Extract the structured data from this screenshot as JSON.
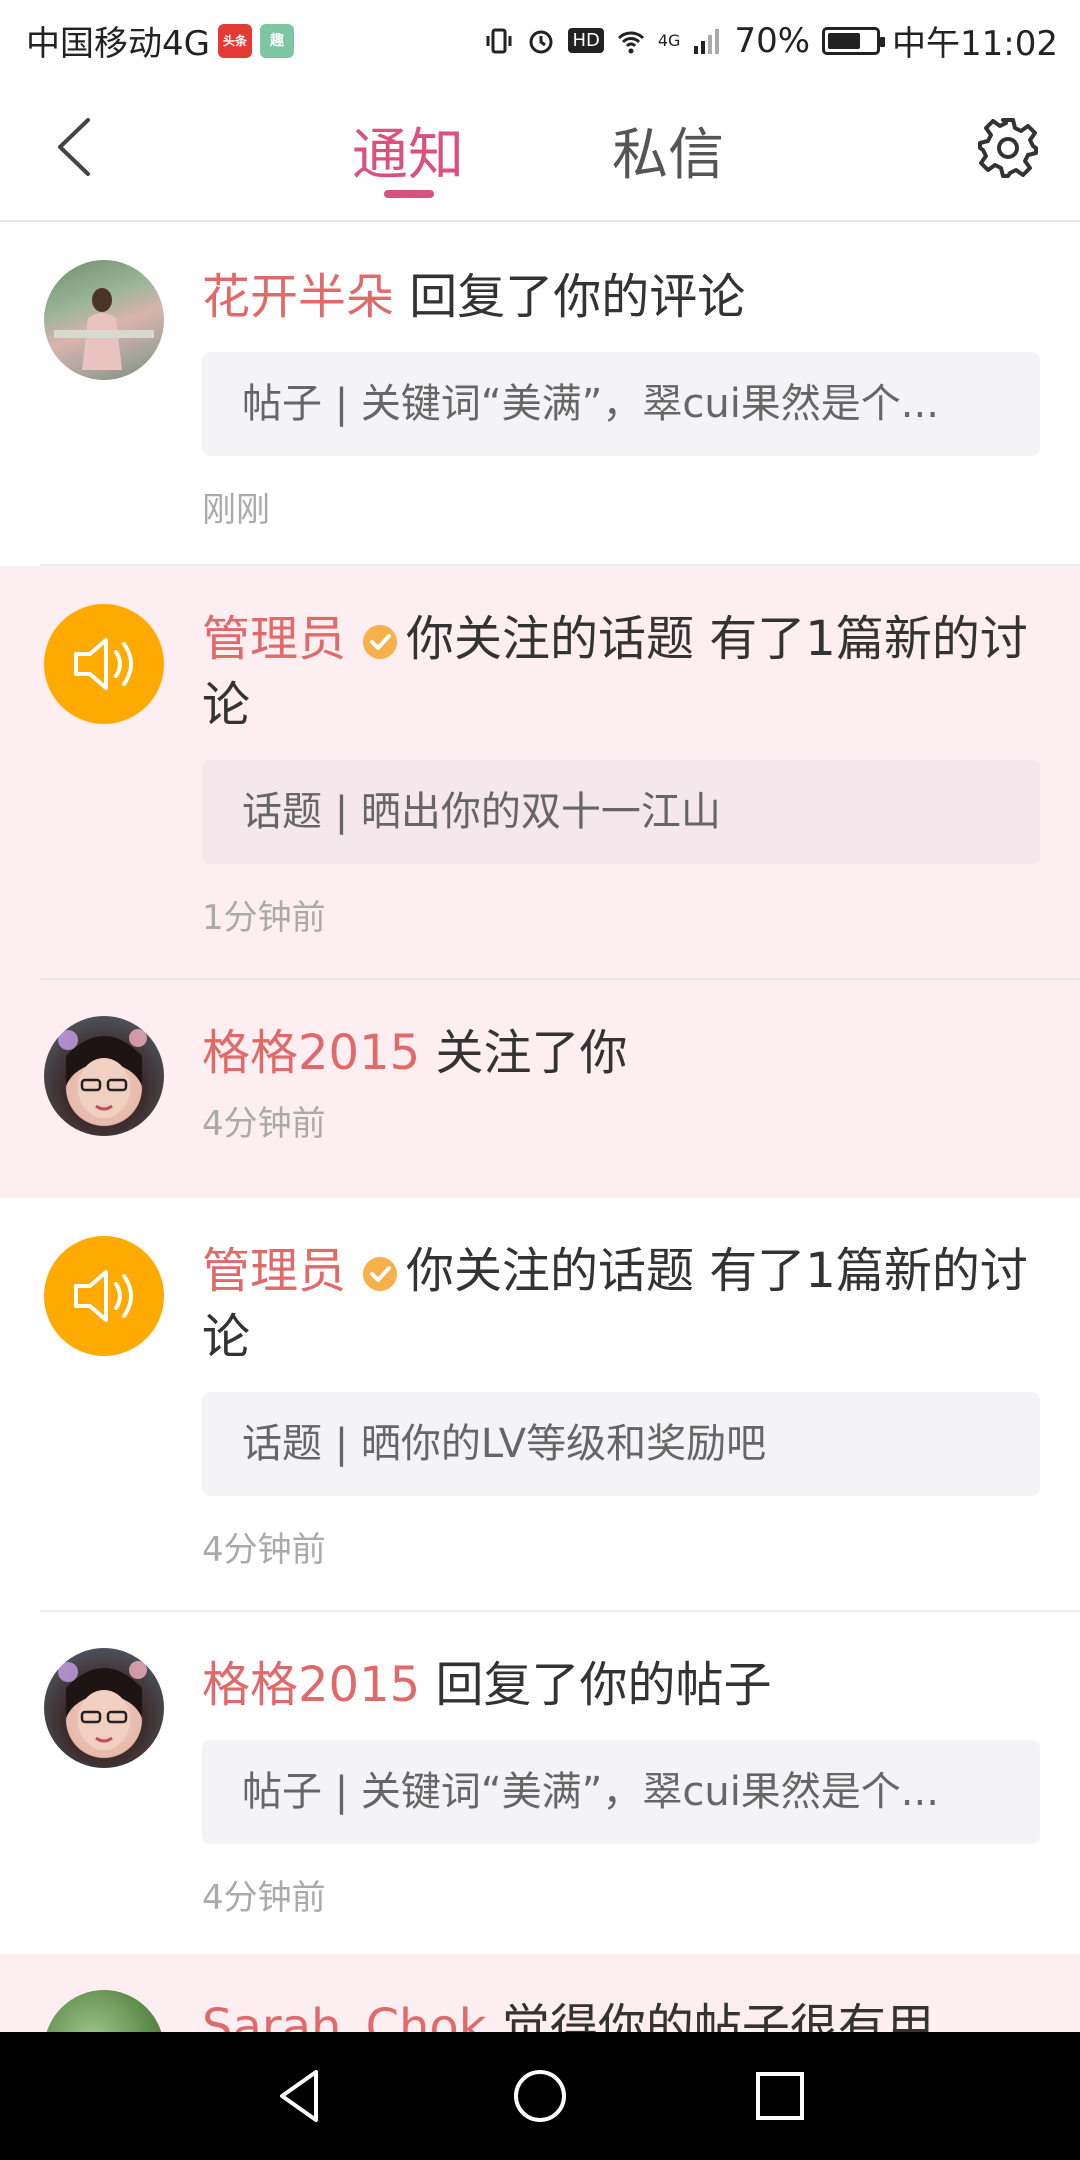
{
  "status_bar": {
    "carrier": "中国移动4G",
    "app_badge_1": "头条",
    "app_badge_2": "趣",
    "hd_label": "HD",
    "network": "4G",
    "battery": "70%",
    "battery_level": 0.7,
    "time": "中午11:02"
  },
  "header": {
    "tabs": [
      {
        "label": "通知",
        "active": true
      },
      {
        "label": "私信",
        "active": false
      }
    ],
    "accent_color": "#d9517d"
  },
  "notifications": [
    {
      "name": "花开半朵",
      "action": "回复了你的评论",
      "quote": "帖子 | 关键词“美满”，翠cui果然是个...",
      "time": "刚刚",
      "avatar": "photo-avatar",
      "highlighted": false
    },
    {
      "name": "管理员",
      "verified": true,
      "action": "你关注的话题 有了1篇新的讨论",
      "quote": "话题 | 晒出你的双十一江山",
      "time": "1分钟前",
      "avatar": "speaker-icon",
      "highlighted": true
    },
    {
      "name": "格格2015",
      "action": "关注了你",
      "time": "4分钟前",
      "avatar": "photo-avatar",
      "highlighted": true
    },
    {
      "name": "管理员",
      "verified": true,
      "action": "你关注的话题 有了1篇新的讨论",
      "quote": "话题 | 晒你的LV等级和奖励吧",
      "time": "4分钟前",
      "avatar": "speaker-icon",
      "highlighted": false
    },
    {
      "name": "格格2015",
      "action": "回复了你的帖子",
      "quote": "帖子 | 关键词“美满”，翠cui果然是个...",
      "time": "4分钟前",
      "avatar": "photo-avatar",
      "highlighted": false
    },
    {
      "name": "Sarah_Chok",
      "action": "觉得你的帖子很有用",
      "avatar": "photo-avatar",
      "highlighted": true
    }
  ]
}
